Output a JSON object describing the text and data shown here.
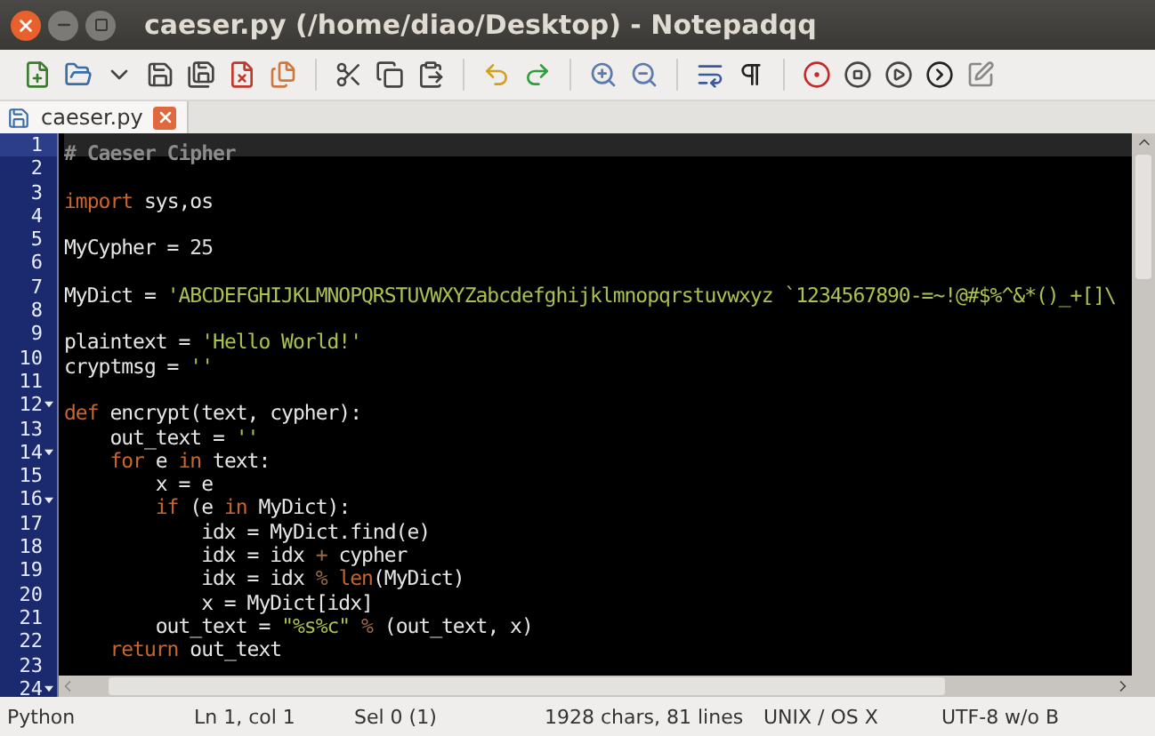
{
  "window": {
    "title": "caeser.py (/home/diao/Desktop) - Notepadqq"
  },
  "tabs": [
    {
      "label": "caeser.py",
      "selected": true
    }
  ],
  "editor": {
    "lines": [
      {
        "number": "1",
        "fold": false,
        "current": true,
        "tokens": [
          {
            "kind": "comment",
            "text": "# Caeser Cipher"
          }
        ]
      },
      {
        "number": "2",
        "fold": false,
        "current": false
      },
      {
        "number": "3",
        "fold": false,
        "current": false,
        "tokens": [
          {
            "kind": "keyword",
            "text": "import"
          },
          {
            "kind": "plain",
            "text": " sys,os"
          }
        ]
      },
      {
        "number": "4",
        "fold": false,
        "current": false
      },
      {
        "number": "5",
        "fold": false,
        "current": false,
        "tokens": [
          {
            "kind": "plain",
            "text": "MyCypher = "
          },
          {
            "kind": "number",
            "text": "25"
          }
        ]
      },
      {
        "number": "6",
        "fold": false,
        "current": false
      },
      {
        "number": "7",
        "fold": false,
        "current": false,
        "tokens": [
          {
            "kind": "plain",
            "text": "MyDict = "
          },
          {
            "kind": "string",
            "text": "'ABCDEFGHIJKLMNOPQRSTUVWXYZabcdefghijklmnopqrstuvwxyz `1234567890-=~!@#$%^&*()_+[]\\"
          }
        ]
      },
      {
        "number": "8",
        "fold": false,
        "current": false
      },
      {
        "number": "9",
        "fold": false,
        "current": false,
        "tokens": [
          {
            "kind": "plain",
            "text": "plaintext = "
          },
          {
            "kind": "string",
            "text": "'Hello World!'"
          }
        ]
      },
      {
        "number": "10",
        "fold": false,
        "current": false,
        "tokens": [
          {
            "kind": "plain",
            "text": "cryptmsg = "
          },
          {
            "kind": "string",
            "text": "''"
          }
        ]
      },
      {
        "number": "11",
        "fold": false,
        "current": false
      },
      {
        "number": "12",
        "fold": true,
        "current": false,
        "tokens": [
          {
            "kind": "keyword",
            "text": "def"
          },
          {
            "kind": "plain",
            "text": " encrypt(text, cypher):"
          }
        ]
      },
      {
        "number": "13",
        "fold": false,
        "current": false,
        "tokens": [
          {
            "kind": "plain",
            "text": "    out_text = "
          },
          {
            "kind": "string",
            "text": "''"
          }
        ]
      },
      {
        "number": "14",
        "fold": true,
        "current": false,
        "tokens": [
          {
            "kind": "keyword",
            "text": "    for"
          },
          {
            "kind": "plain",
            "text": " e "
          },
          {
            "kind": "keyword",
            "text": "in"
          },
          {
            "kind": "plain",
            "text": " text:"
          }
        ]
      },
      {
        "number": "15",
        "fold": false,
        "current": false,
        "tokens": [
          {
            "kind": "plain",
            "text": "        x = e"
          }
        ]
      },
      {
        "number": "16",
        "fold": true,
        "current": false,
        "tokens": [
          {
            "kind": "keyword",
            "text": "        if"
          },
          {
            "kind": "plain",
            "text": " (e "
          },
          {
            "kind": "keyword",
            "text": "in"
          },
          {
            "kind": "plain",
            "text": " MyDict):"
          }
        ]
      },
      {
        "number": "17",
        "fold": false,
        "current": false,
        "tokens": [
          {
            "kind": "plain",
            "text": "            idx = MyDict.find(e)"
          }
        ]
      },
      {
        "number": "18",
        "fold": false,
        "current": false,
        "tokens": [
          {
            "kind": "plain",
            "text": "            idx = idx "
          },
          {
            "kind": "operator",
            "text": "+"
          },
          {
            "kind": "plain",
            "text": " cypher"
          }
        ]
      },
      {
        "number": "19",
        "fold": false,
        "current": false,
        "tokens": [
          {
            "kind": "plain",
            "text": "            idx = idx "
          },
          {
            "kind": "operator",
            "text": "%"
          },
          {
            "kind": "keyword",
            "text": " len"
          },
          {
            "kind": "plain",
            "text": "(MyDict)"
          }
        ]
      },
      {
        "number": "20",
        "fold": false,
        "current": false,
        "tokens": [
          {
            "kind": "plain",
            "text": "            x = MyDict[idx]"
          }
        ]
      },
      {
        "number": "21",
        "fold": false,
        "current": false,
        "tokens": [
          {
            "kind": "plain",
            "text": "        out_text = "
          },
          {
            "kind": "string",
            "text": "\"%s%c\""
          },
          {
            "kind": "operator",
            "text": " %"
          },
          {
            "kind": "plain",
            "text": " (out_text, x)"
          }
        ]
      },
      {
        "number": "22",
        "fold": false,
        "current": false,
        "tokens": [
          {
            "kind": "keyword",
            "text": "    return"
          },
          {
            "kind": "plain",
            "text": " out_text"
          }
        ]
      },
      {
        "number": "23",
        "fold": false,
        "current": false
      },
      {
        "number": "24",
        "fold": true,
        "current": false
      }
    ]
  },
  "status_bar": [
    "Python",
    "Ln 1, col 1",
    "Sel 0 (1)",
    "1928 chars, 81 lines",
    "UNIX / OS X",
    "UTF-8 w/o B"
  ]
}
